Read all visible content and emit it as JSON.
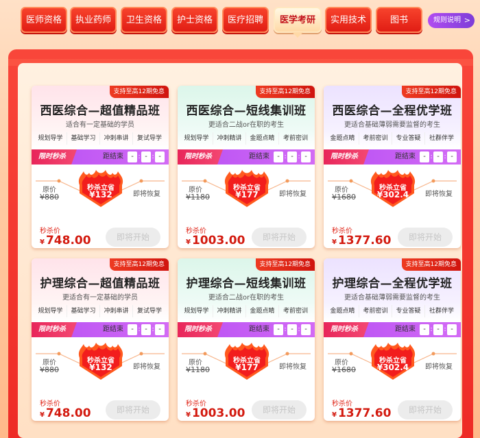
{
  "nav": {
    "tabs": [
      {
        "label": "医师资格",
        "active": false
      },
      {
        "label": "执业药师",
        "active": false
      },
      {
        "label": "卫生资格",
        "active": false
      },
      {
        "label": "护士资格",
        "active": false
      },
      {
        "label": "医疗招聘",
        "active": false
      },
      {
        "label": "医学考研",
        "active": true
      },
      {
        "label": "实用技术",
        "active": false
      },
      {
        "label": "图书",
        "active": false
      }
    ],
    "rules_label": "规则说明",
    "rules_arrow": ">"
  },
  "common": {
    "badge": "支持至高12期免息",
    "flash_label": "限时秒杀",
    "countdown_label": "距结束",
    "countdown_hours": "-",
    "countdown_minutes": "-",
    "countdown_seconds": "-",
    "countdown_sep": ":",
    "flame_title": "秒杀立省",
    "orig_label": "原价",
    "restore_label": "即将恢复",
    "sale_label": "秒杀价",
    "start_label": "即将开始"
  },
  "colors": {
    "accent_red": "#e11d14",
    "flash_purple": "#b64ff3",
    "sale_red": "#d31a0f"
  },
  "cards": [
    {
      "theme": "pink",
      "title": "西医综合—超值精品班",
      "subtitle": "适合有一定基础的学员",
      "tags": [
        "规划导学",
        "基础学习",
        "冲刺串讲",
        "复试导学"
      ],
      "save": "¥132",
      "orig": "¥880",
      "yen": "¥",
      "price": "748.00"
    },
    {
      "theme": "green",
      "title": "西医综合—短线集训班",
      "subtitle": "更适合二战or在职的考生",
      "tags": [
        "规划导学",
        "冲刺精讲",
        "金题点睛",
        "考前密训"
      ],
      "save": "¥177",
      "orig": "¥1180",
      "yen": "¥",
      "price": "1003.00"
    },
    {
      "theme": "purple",
      "title": "西医综合—全程优学班",
      "subtitle": "更适合基础薄弱需要监督的考生",
      "tags": [
        "金题点睛",
        "考前密训",
        "专业答疑",
        "社群伴学"
      ],
      "save": "¥302.4",
      "orig": "¥1680",
      "yen": "¥",
      "price": "1377.60"
    },
    {
      "theme": "pink",
      "title": "护理综合—超值精品班",
      "subtitle": "更适合有一定基础的学员",
      "tags": [
        "规划导学",
        "基础学习",
        "冲刺串讲",
        "复试导学"
      ],
      "save": "¥132",
      "orig": "¥880",
      "yen": "¥",
      "price": "748.00"
    },
    {
      "theme": "green",
      "title": "护理综合—短线集训班",
      "subtitle": "更适合二战or在职的考生",
      "tags": [
        "规划导学",
        "冲刺精讲",
        "金题点睛",
        "考前密训"
      ],
      "save": "¥177",
      "orig": "¥1180",
      "yen": "¥",
      "price": "1003.00"
    },
    {
      "theme": "purple",
      "title": "护理综合—全程优学班",
      "subtitle": "更适合基础薄弱需要监督的考生",
      "tags": [
        "金题点睛",
        "考前密训",
        "专业答疑",
        "社群伴学"
      ],
      "save": "¥302.4",
      "orig": "¥1680",
      "yen": "¥",
      "price": "1377.60"
    }
  ]
}
